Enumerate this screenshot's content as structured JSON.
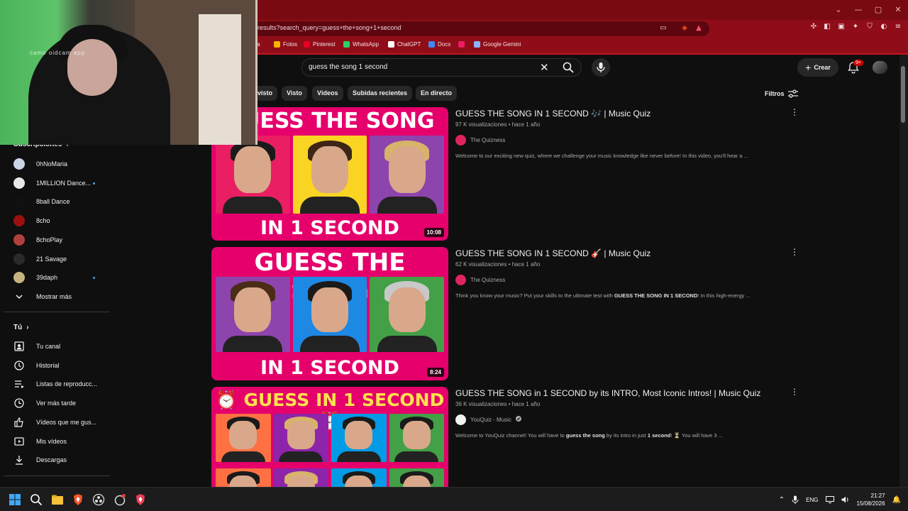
{
  "browser": {
    "url": "results?search_query=guess+the+song+1+second",
    "window_controls": [
      "⌄",
      "—",
      "▢",
      "✕"
    ],
    "bookmarks": [
      {
        "label": "va",
        "color": "#d0d0d0"
      },
      {
        "label": "Fotos",
        "color": "#f4b400"
      },
      {
        "label": "Pinterest",
        "color": "#e60023"
      },
      {
        "label": "WhatsApp",
        "color": "#25d366"
      },
      {
        "label": "ChatGPT",
        "color": "#ffffff"
      },
      {
        "label": "Docs",
        "color": "#4285f4"
      },
      {
        "label": "",
        "color": "#e91e63"
      },
      {
        "label": "Google Gemini",
        "color": "#8ab4f8"
      }
    ]
  },
  "webcam": {
    "overlay_text": "camo  oidcam app"
  },
  "masthead": {
    "search_value": "guess the song 1 second",
    "create_label": "Crear",
    "notification_count": "9+"
  },
  "chips": [
    "visto",
    "Visto",
    "Vídeos",
    "Subidas recientes",
    "En directo"
  ],
  "filters_label": "Filtros",
  "sidebar": {
    "subscriptions_header": "Suscripciones",
    "subscriptions": [
      {
        "label": "0hNoMaria",
        "color": "#c9d4e6",
        "dot": false
      },
      {
        "label": "1MILLION Dance...",
        "color": "#e8e8e8",
        "dot": true
      },
      {
        "label": "8ball Dance",
        "color": "#111111",
        "dot": false
      },
      {
        "label": "8cho",
        "color": "#9c1010",
        "dot": false
      },
      {
        "label": "8choPlay",
        "color": "#b04040",
        "dot": false
      },
      {
        "label": "21 Savage",
        "color": "#2a2a2a",
        "dot": false
      },
      {
        "label": "39daph",
        "color": "#c8b480",
        "dot": true
      }
    ],
    "show_more": "Mostrar más",
    "you_header": "Tú",
    "you_items": [
      {
        "label": "Tu canal",
        "icon": "channel-icon"
      },
      {
        "label": "Historial",
        "icon": "history-icon"
      },
      {
        "label": "Listas de reproducc...",
        "icon": "playlist-icon"
      },
      {
        "label": "Ver más tarde",
        "icon": "clock-icon"
      },
      {
        "label": "Vídeos que me gus...",
        "icon": "thumb-up-icon"
      },
      {
        "label": "Mis vídeos",
        "icon": "my-videos-icon"
      },
      {
        "label": "Descargas",
        "icon": "download-icon"
      }
    ]
  },
  "results": [
    {
      "title": "GUESS THE SONG IN 1 SECOND 🎶 | Music Quiz",
      "views": "97 K visualizaciones",
      "age": "hace 1 año",
      "channel": "The Quizness",
      "channel_color": "#e0245e",
      "verified": false,
      "description_parts": [
        {
          "t": "Welcome to our exciting new quiz, where we challenge your music knowledge like never before! In this video, you'll hear a ...",
          "b": false
        }
      ],
      "duration": "10:08",
      "thumb_top_text": "GUESS THE SONG",
      "thumb_bottom_text": "IN 1 SECOND",
      "thumb_tile_colors": [
        "#e91e63",
        "#f9d423",
        "#8e44ad"
      ],
      "thumb_hair_colors": [
        "#1a1a1a",
        "#3d2616",
        "#d8b36a"
      ]
    },
    {
      "title": "GUESS THE SONG IN 1 SECOND 🎸 | Music Quiz",
      "views": "62 K visualizaciones",
      "age": "hace 1 año",
      "channel": "The Quizness",
      "channel_color": "#e0245e",
      "verified": false,
      "description_parts": [
        {
          "t": "Think you know your music? Put your skills to the ultimate test with ",
          "b": false
        },
        {
          "t": "GUESS THE SONG IN 1 SECOND",
          "b": true
        },
        {
          "t": "! In this high-energy ...",
          "b": false
        }
      ],
      "duration": "8:24",
      "thumb_top_text": "GUESS THE SONG",
      "thumb_bottom_text": "IN 1 SECOND",
      "thumb_tile_colors": [
        "#8e44ad",
        "#1e88e5",
        "#43a047"
      ],
      "thumb_hair_colors": [
        "#4a2c17",
        "#1a1a1a",
        "#c8c8c8"
      ]
    },
    {
      "title": "GUESS THE SONG in 1 SECOND by its INTRO, Most Iconic Intros! | Music Quiz",
      "views": "36 K visualizaciones",
      "age": "hace 1 año",
      "channel": "YouQuiz - Music",
      "channel_color": "#f2f2f2",
      "verified": true,
      "description_parts": [
        {
          "t": "Welcome to YouQuiz channel! You will have to ",
          "b": false
        },
        {
          "t": "guess the song",
          "b": true
        },
        {
          "t": " by its intro in just ",
          "b": false
        },
        {
          "t": "1 second",
          "b": true
        },
        {
          "t": "! ⏳ You will have 3 ...",
          "b": false
        }
      ],
      "duration": "",
      "thumb_top_text": "⏰ GUESS IN 1 SECOND ⏰",
      "thumb_bottom_text": "",
      "thumb_tile_colors": [
        "#ff7043",
        "#8e24aa",
        "#039be5",
        "#43a047"
      ],
      "thumb_hair_colors": [
        "#1a1a1a",
        "#d8b36a",
        "#1a1a1a",
        "#1a1a1a"
      ]
    }
  ],
  "taskbar": {
    "language": "ENG",
    "time": "21:27",
    "date": "15/08/2026"
  }
}
